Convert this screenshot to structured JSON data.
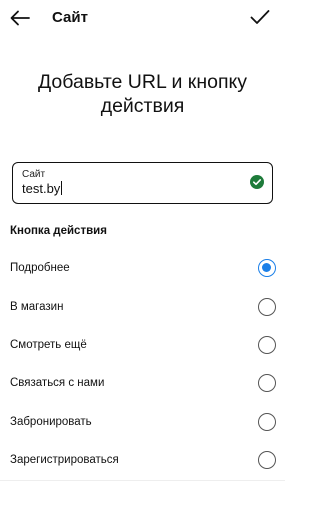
{
  "header": {
    "title": "Сайт",
    "back_icon": "arrow-left-icon",
    "confirm_icon": "checkmark-icon"
  },
  "heading": {
    "line1": "Добавьте URL и кнопку",
    "line2": "действия"
  },
  "website_field": {
    "label": "Сайт",
    "value": "test.by",
    "status_icon": "check-circle-icon",
    "status_color": "#1e7b3a"
  },
  "action_section": {
    "label": "Кнопка действия",
    "selected_color": "#1a7fe8",
    "options": [
      {
        "label": "Подробнее",
        "selected": true
      },
      {
        "label": "В магазин",
        "selected": false
      },
      {
        "label": "Смотреть ещё",
        "selected": false
      },
      {
        "label": "Связаться с нами",
        "selected": false
      },
      {
        "label": "Забронировать",
        "selected": false
      },
      {
        "label": "Зарегистрироваться",
        "selected": false
      }
    ]
  }
}
